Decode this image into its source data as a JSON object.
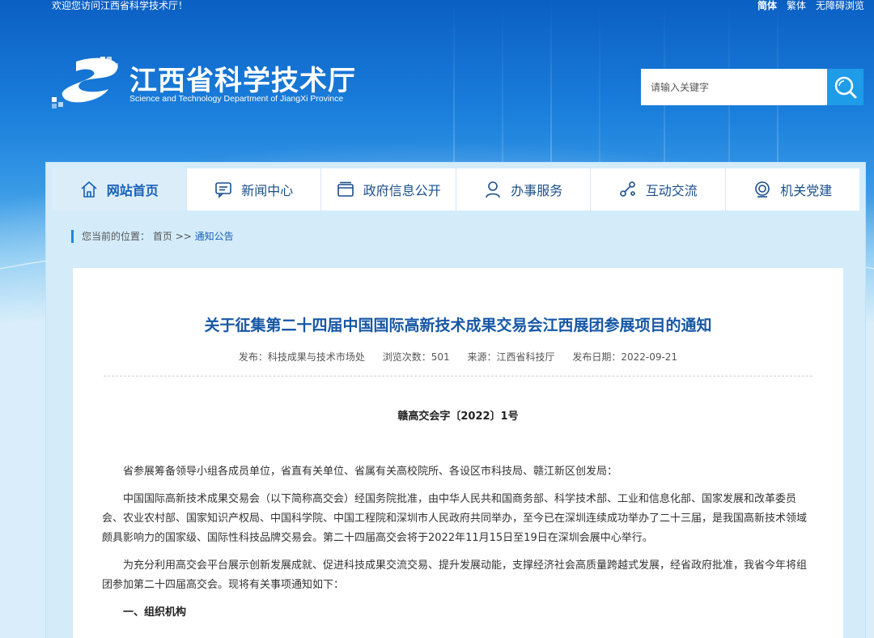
{
  "topbar": {
    "welcome": "欢迎您访问江西省科学技术厅！",
    "simplified": "简体",
    "traditional": "繁体",
    "accessibility": "无障碍浏览"
  },
  "logo": {
    "cn": "江西省科学技术厅",
    "en": "Science and Technology Department of JiangXi Province",
    "icon": "department-logo-icon"
  },
  "search": {
    "placeholder": "请输入关键字",
    "icon": "search-icon"
  },
  "nav": {
    "items": [
      {
        "label": "网站首页",
        "icon": "home-icon"
      },
      {
        "label": "新闻中心",
        "icon": "message-icon"
      },
      {
        "label": "政府信息公开",
        "icon": "folder-icon"
      },
      {
        "label": "办事服务",
        "icon": "user-icon"
      },
      {
        "label": "互动交流",
        "icon": "share-icon"
      },
      {
        "label": "机关党建",
        "icon": "badge-icon"
      }
    ]
  },
  "breadcrumb": {
    "prefix": "您当前的位置：",
    "home": "首页",
    "sep": ">>",
    "current": "通知公告"
  },
  "article": {
    "title": "关于征集第二十四届中国国际高新技术成果交易会江西展团参展项目的通知",
    "meta": {
      "publisher": "发布：科技成果与技术市场处",
      "views": "浏览次数：501",
      "source": "来源：江西省科技厅",
      "date": "发布日期：2022-09-21"
    },
    "doc_no": "赣高交会字〔2022〕1号",
    "paragraphs": [
      "省参展筹备领导小组各成员单位，省直有关单位、省属有关高校院所、各设区市科技局、赣江新区创发局：",
      "中国国际高新技术成果交易会（以下简称高交会）经国务院批准，由中华人民共和国商务部、科学技术部、工业和信息化部、国家发展和改革委员会、农业农村部、国家知识产权局、中国科学院、中国工程院和深圳市人民政府共同举办，至今已在深圳连续成功举办了二十三届，是我国高新技术领域颇具影响力的国家级、国际性科技品牌交易会。第二十四届高交会将于2022年11月15日至19日在深圳会展中心举行。",
      "为充分利用高交会平台展示创新发展成就、促进科技成果交流交易、提升发展动能，支撑经济社会高质量跨越式发展，经省政府批准，我省今年将组团参加第二十四届高交会。现将有关事项通知如下："
    ],
    "section1": "一、组织机构"
  },
  "colors": {
    "primary": "#1660b8",
    "title": "#1757a6",
    "search_btn": "#1e9ce8"
  }
}
